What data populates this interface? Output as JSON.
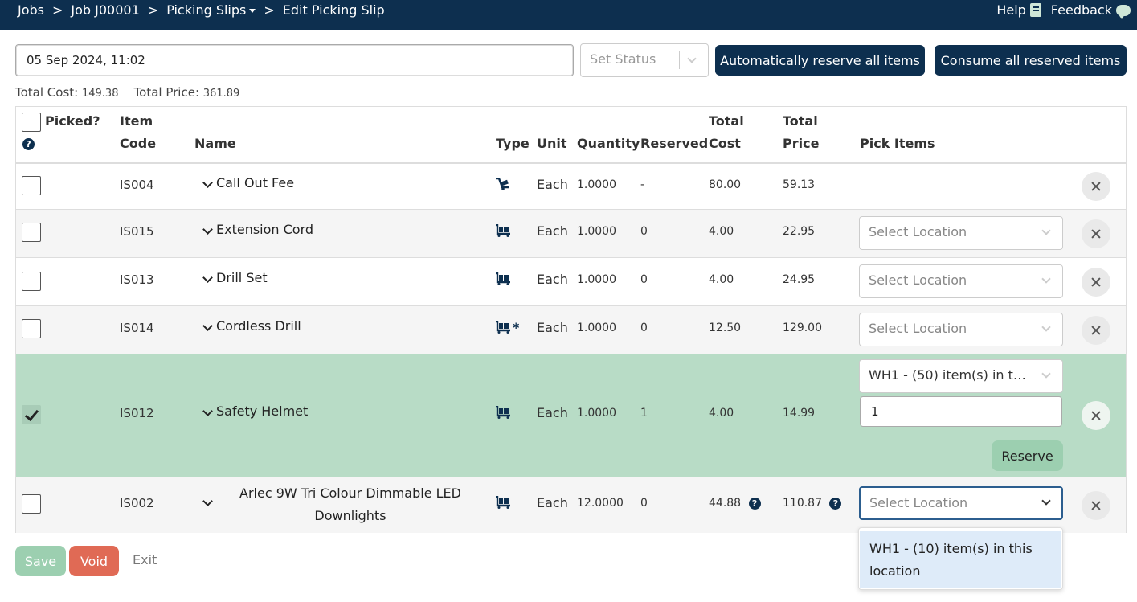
{
  "breadcrumb": {
    "items": [
      "Jobs",
      "Job J00001",
      "Picking Slips",
      "Edit Picking Slip"
    ],
    "separator": ">"
  },
  "top_right": {
    "help_label": "Help",
    "feedback_label": "Feedback"
  },
  "form": {
    "date_value": "05 Sep 2024, 11:02",
    "status_placeholder": "Set Status",
    "auto_reserve_label": "Automatically reserve all items",
    "consume_label": "Consume all reserved items"
  },
  "totals": {
    "cost_label": "Total Cost:",
    "cost_value": "149.38",
    "price_label": "Total Price:",
    "price_value": "361.89"
  },
  "table": {
    "headers": {
      "picked": "Picked?",
      "item_code_1": "Item",
      "item_code_2": "Code",
      "name": "Name",
      "type": "Type",
      "unit": "Unit",
      "quantity": "Quantity",
      "reserved": "Reserved",
      "total_cost_1": "Total",
      "total_cost_2": "Cost",
      "total_price_1": "Total",
      "total_price_2": "Price",
      "pick_items": "Pick Items"
    },
    "rows": [
      {
        "code": "IS004",
        "name": "Call Out Fee",
        "type_icon": "service-trolley-icon",
        "unit": "Each",
        "quantity": "1.0000",
        "reserved": "-",
        "total_cost": "80.00",
        "total_price": "59.13",
        "picked": false
      },
      {
        "code": "IS015",
        "name": "Extension Cord",
        "type_icon": "cart-icon",
        "unit": "Each",
        "quantity": "1.0000",
        "reserved": "0",
        "total_cost": "4.00",
        "total_price": "22.95",
        "location_placeholder": "Select Location",
        "picked": false
      },
      {
        "code": "IS013",
        "name": "Drill Set",
        "type_icon": "cart-icon",
        "unit": "Each",
        "quantity": "1.0000",
        "reserved": "0",
        "total_cost": "4.00",
        "total_price": "24.95",
        "location_placeholder": "Select Location",
        "picked": false
      },
      {
        "code": "IS014",
        "name": "Cordless Drill",
        "type_icon": "cart-serialized-icon",
        "unit": "Each",
        "quantity": "1.0000",
        "reserved": "0",
        "total_cost": "12.50",
        "total_price": "129.00",
        "location_placeholder": "Select Location",
        "picked": false
      },
      {
        "code": "IS012",
        "name": "Safety Helmet",
        "type_icon": "cart-icon",
        "unit": "Each",
        "quantity": "1.0000",
        "reserved": "1",
        "total_cost": "4.00",
        "total_price": "14.99",
        "location_value": "WH1 - (50) item(s) in this...",
        "pick_qty": "1",
        "reserve_label": "Reserve",
        "picked": true
      },
      {
        "code": "IS002",
        "name_line1": "Arlec 9W Tri Colour Dimmable LED",
        "name_line2": "Downlights",
        "type_icon": "cart-icon",
        "unit": "Each",
        "quantity": "12.0000",
        "reserved": "0",
        "total_cost": "44.88",
        "total_price": "110.87",
        "location_placeholder": "Select Location",
        "picked": false
      }
    ]
  },
  "dropdown": {
    "option_line1": "WH1 - (10) item(s) in this",
    "option_line2": "location"
  },
  "footer": {
    "save_label": "Save",
    "void_label": "Void",
    "exit_label": "Exit"
  },
  "colors": {
    "navbar": "#0d2f4f",
    "picked_row": "#b8dcc6",
    "save": "#9ccfb0",
    "void": "#e06a55"
  }
}
